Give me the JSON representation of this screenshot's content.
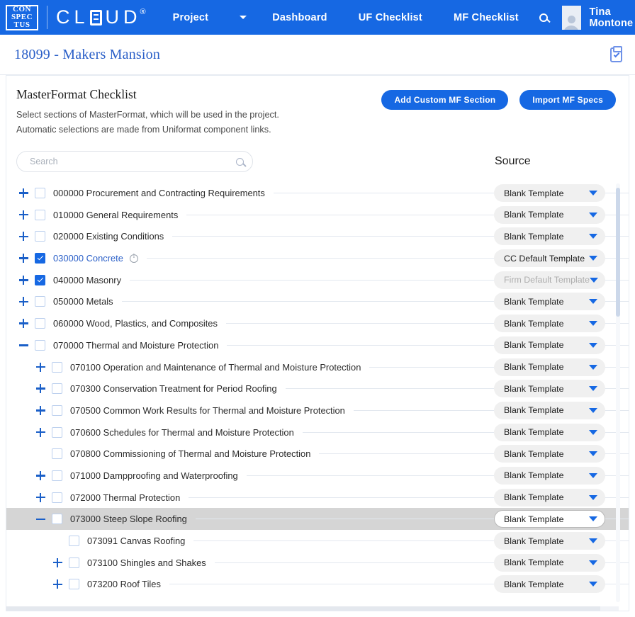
{
  "topnav": {
    "logo_lines": [
      "CON",
      "SPEC",
      "TUS"
    ],
    "logo_word_a": "CL",
    "logo_word_b": "UD",
    "logo_reg": "®",
    "project_label": "Project",
    "items": [
      {
        "label": "Dashboard"
      },
      {
        "label": "UF Checklist"
      },
      {
        "label": "MF Checklist"
      }
    ],
    "search_icon": "search-icon",
    "user_name": "Tina Montone"
  },
  "projectbar": {
    "title": "18099 - Makers Mansion",
    "clipboard_icon": "clipboard-check-icon"
  },
  "card": {
    "title": "MasterFormat Checklist",
    "subtitle_line1": "Select sections of MasterFormat, which will be used in the project.",
    "subtitle_line2": "Automatic selections are made from Uniformat component links.",
    "add_custom_button": "Add Custom MF Section",
    "import_button": "Import MF Specs",
    "search_placeholder": "Search",
    "search_value": "",
    "source_header": "Source"
  },
  "rows": [
    {
      "indent": 0,
      "toggle": "plus",
      "checked": false,
      "label": "000000 Procurement and Contracting Requirements",
      "link": false,
      "info": false,
      "source": "Blank Template",
      "source_muted": false,
      "hovered": false
    },
    {
      "indent": 0,
      "toggle": "plus",
      "checked": false,
      "label": "010000 General Requirements",
      "link": false,
      "info": false,
      "source": "Blank Template",
      "source_muted": false,
      "hovered": false
    },
    {
      "indent": 0,
      "toggle": "plus",
      "checked": false,
      "label": "020000 Existing Conditions",
      "link": false,
      "info": false,
      "source": "Blank Template",
      "source_muted": false,
      "hovered": false
    },
    {
      "indent": 0,
      "toggle": "plus",
      "checked": true,
      "label": "030000 Concrete",
      "link": true,
      "info": true,
      "source": "CC Default Template",
      "source_muted": false,
      "hovered": false
    },
    {
      "indent": 0,
      "toggle": "plus",
      "checked": true,
      "label": "040000 Masonry",
      "link": false,
      "info": false,
      "source": "Firm Default Template",
      "source_muted": true,
      "hovered": false
    },
    {
      "indent": 0,
      "toggle": "plus",
      "checked": false,
      "label": "050000 Metals",
      "link": false,
      "info": false,
      "source": "Blank Template",
      "source_muted": false,
      "hovered": false
    },
    {
      "indent": 0,
      "toggle": "plus",
      "checked": false,
      "label": "060000 Wood, Plastics, and Composites",
      "link": false,
      "info": false,
      "source": "Blank Template",
      "source_muted": false,
      "hovered": false
    },
    {
      "indent": 0,
      "toggle": "minus",
      "checked": false,
      "label": "070000 Thermal and Moisture Protection",
      "link": false,
      "info": false,
      "source": "Blank Template",
      "source_muted": false,
      "hovered": false
    },
    {
      "indent": 1,
      "toggle": "plus",
      "checked": false,
      "label": "070100 Operation and Maintenance of Thermal and Moisture Protection",
      "link": false,
      "info": false,
      "source": "Blank Template",
      "source_muted": false,
      "hovered": false
    },
    {
      "indent": 1,
      "toggle": "plus",
      "checked": false,
      "label": "070300 Conservation Treatment for Period Roofing",
      "link": false,
      "info": false,
      "source": "Blank Template",
      "source_muted": false,
      "hovered": false
    },
    {
      "indent": 1,
      "toggle": "plus",
      "checked": false,
      "label": "070500 Common Work Results for Thermal and Moisture Protection",
      "link": false,
      "info": false,
      "source": "Blank Template",
      "source_muted": false,
      "hovered": false
    },
    {
      "indent": 1,
      "toggle": "plus",
      "checked": false,
      "label": "070600 Schedules for Thermal and Moisture Protection",
      "link": false,
      "info": false,
      "source": "Blank Template",
      "source_muted": false,
      "hovered": false
    },
    {
      "indent": 1,
      "toggle": "none",
      "checked": false,
      "label": "070800 Commissioning of Thermal and Moisture Protection",
      "link": false,
      "info": false,
      "source": "Blank Template",
      "source_muted": false,
      "hovered": false
    },
    {
      "indent": 1,
      "toggle": "plus",
      "checked": false,
      "label": "071000 Dampproofing and Waterproofing",
      "link": false,
      "info": false,
      "source": "Blank Template",
      "source_muted": false,
      "hovered": false
    },
    {
      "indent": 1,
      "toggle": "plus",
      "checked": false,
      "label": "072000 Thermal Protection",
      "link": false,
      "info": false,
      "source": "Blank Template",
      "source_muted": false,
      "hovered": false
    },
    {
      "indent": 1,
      "toggle": "minus",
      "checked": false,
      "label": "073000 Steep Slope Roofing",
      "link": false,
      "info": false,
      "source": "Blank Template",
      "source_muted": false,
      "hovered": true
    },
    {
      "indent": 2,
      "toggle": "none",
      "checked": false,
      "label": "073091 Canvas Roofing",
      "link": false,
      "info": false,
      "source": "Blank Template",
      "source_muted": false,
      "hovered": false
    },
    {
      "indent": 2,
      "toggle": "plus",
      "checked": false,
      "label": "073100 Shingles and Shakes",
      "link": false,
      "info": false,
      "source": "Blank Template",
      "source_muted": false,
      "hovered": false
    },
    {
      "indent": 2,
      "toggle": "plus",
      "checked": false,
      "label": "073200 Roof Tiles",
      "link": false,
      "info": false,
      "source": "Blank Template",
      "source_muted": false,
      "hovered": false
    }
  ],
  "colors": {
    "brand_blue": "#1668e3",
    "link_blue": "#2a5fc8",
    "hover_gray": "#d5d5d5"
  }
}
